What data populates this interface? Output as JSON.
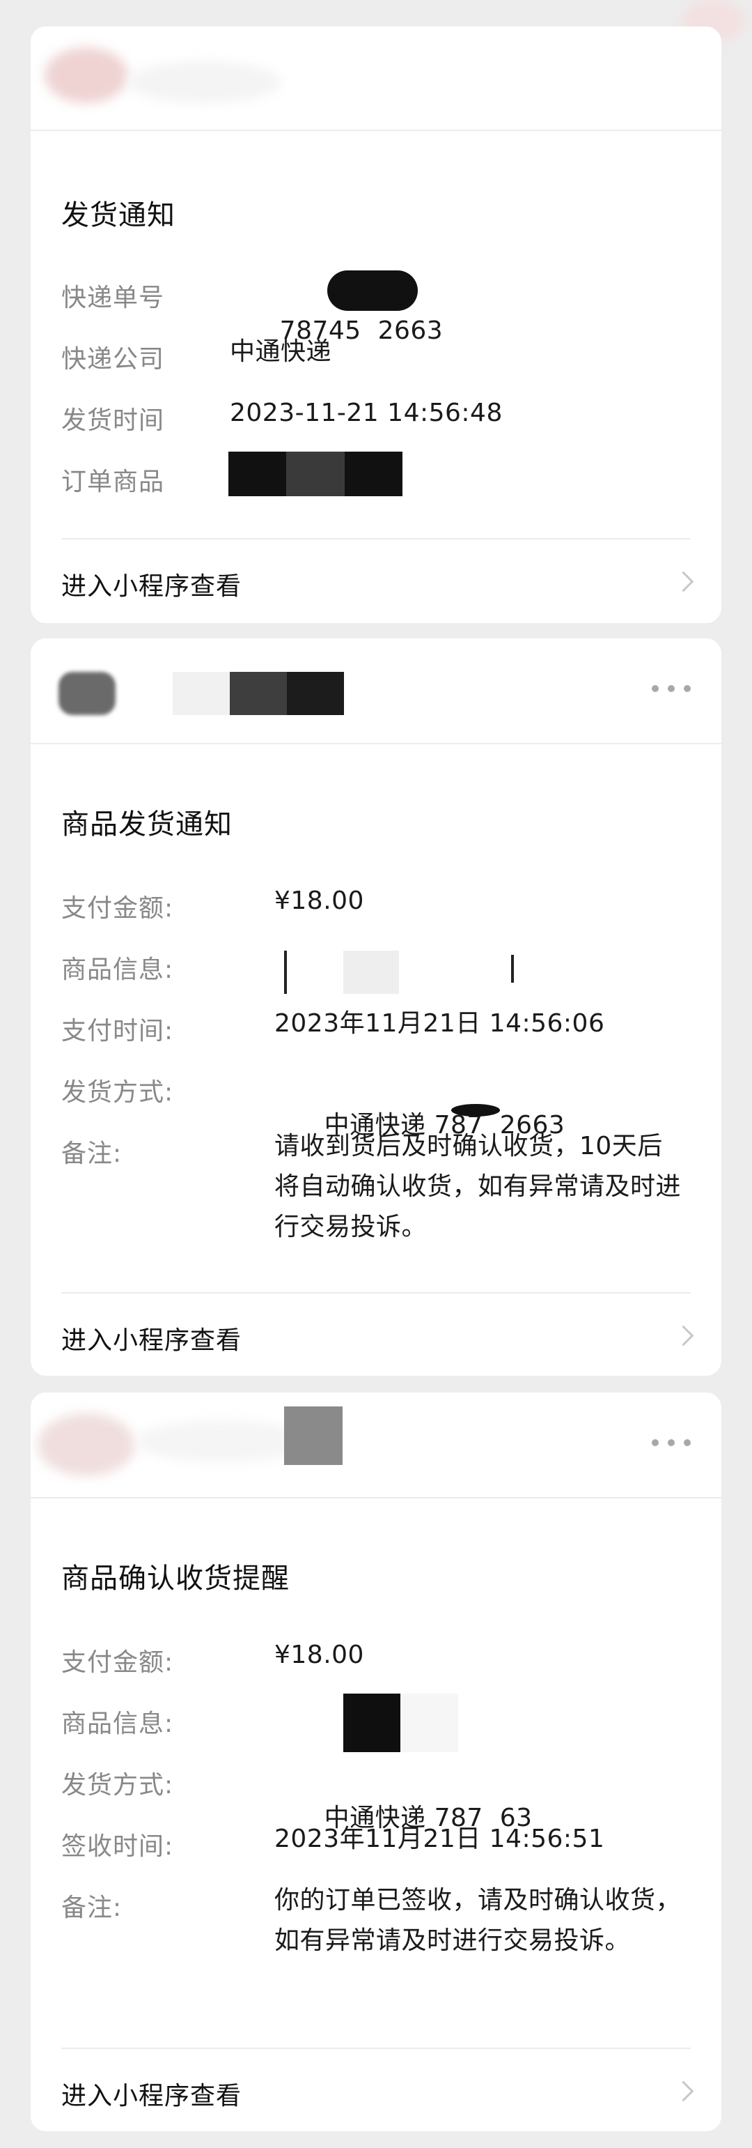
{
  "cards": [
    {
      "title": "发货通知",
      "fields": [
        {
          "label": "快递单号",
          "value": "78745  2663"
        },
        {
          "label": "快递公司",
          "value": "中通快递"
        },
        {
          "label": "发货时间",
          "value": "2023-11-21 14:56:48"
        },
        {
          "label": "订单商品",
          "value": ""
        }
      ],
      "footer_link": "进入小程序查看"
    },
    {
      "title": "商品发货通知",
      "fields": [
        {
          "label": "支付金额:",
          "value": "¥18.00"
        },
        {
          "label": "商品信息:",
          "value": ""
        },
        {
          "label": "支付时间:",
          "value": "2023年11月21日 14:56:06"
        },
        {
          "label": "发货方式:",
          "value": "中通快递 787  2663"
        },
        {
          "label": "备注:",
          "value": "请收到货后及时确认收货，10天后将自动确认收货，如有异常请及时进行交易投诉。"
        }
      ],
      "footer_link": "进入小程序查看"
    },
    {
      "title": "商品确认收货提醒",
      "fields": [
        {
          "label": "支付金额:",
          "value": "¥18.00"
        },
        {
          "label": "商品信息:",
          "value": ""
        },
        {
          "label": "发货方式:",
          "value": "中通快递 787  63"
        },
        {
          "label": "签收时间:",
          "value": "2023年11月21日 14:56:51"
        },
        {
          "label": "备注:",
          "value": "你的订单已签收，请及时确认收货，如有异常请及时进行交易投诉。"
        }
      ],
      "footer_link": "进入小程序查看"
    }
  ],
  "icons": {
    "more": "more-dots-icon",
    "chevron": "chevron-right-icon"
  },
  "colors": {
    "background": "#ededed",
    "card": "#ffffff",
    "label": "#888888",
    "text": "#111111",
    "divider": "#ececec"
  }
}
